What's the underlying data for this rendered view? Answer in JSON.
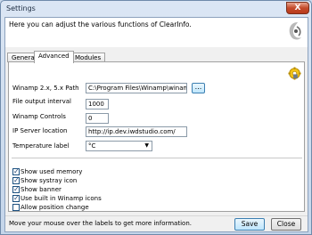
{
  "window": {
    "title": "Settings",
    "close_glyph": "X"
  },
  "header": {
    "text": "Here you can adjust the various functions of ClearInfo."
  },
  "tabs": [
    {
      "label": "General"
    },
    {
      "label": "Advanced",
      "active": true
    },
    {
      "label": "Modules"
    }
  ],
  "fields": {
    "winamp_path": {
      "label": "Winamp 2.x, 5.x Path",
      "value": "C:\\Program Files\\Winamp\\winamp.e",
      "browse_label": "..."
    },
    "file_output_interval": {
      "label": "File output interval",
      "value": "1000"
    },
    "winamp_controls": {
      "label": "Winamp Controls",
      "value": "0"
    },
    "ip_server_location": {
      "label": "IP Server location",
      "value": "http://ip.dev.iwdstudio.com/"
    },
    "temperature_label": {
      "label": "Temperature label",
      "value": "°C"
    }
  },
  "checkboxes": [
    {
      "label": "Show used memory",
      "checked": true
    },
    {
      "label": "Show systray icon",
      "checked": true
    },
    {
      "label": "Show banner",
      "checked": true
    },
    {
      "label": "Use built in Winamp icons",
      "checked": true
    },
    {
      "label": "Allow position change",
      "checked": false
    }
  ],
  "status": {
    "text": "Move your mouse over the labels to get more information."
  },
  "buttons": {
    "save": "Save",
    "close": "Close"
  },
  "icons": {
    "header_logo": "clearinfo-logo-icon",
    "settings": "gear-icon"
  },
  "colors": {
    "accent": "#3c7fb1",
    "close_button": "#c44a2a"
  }
}
